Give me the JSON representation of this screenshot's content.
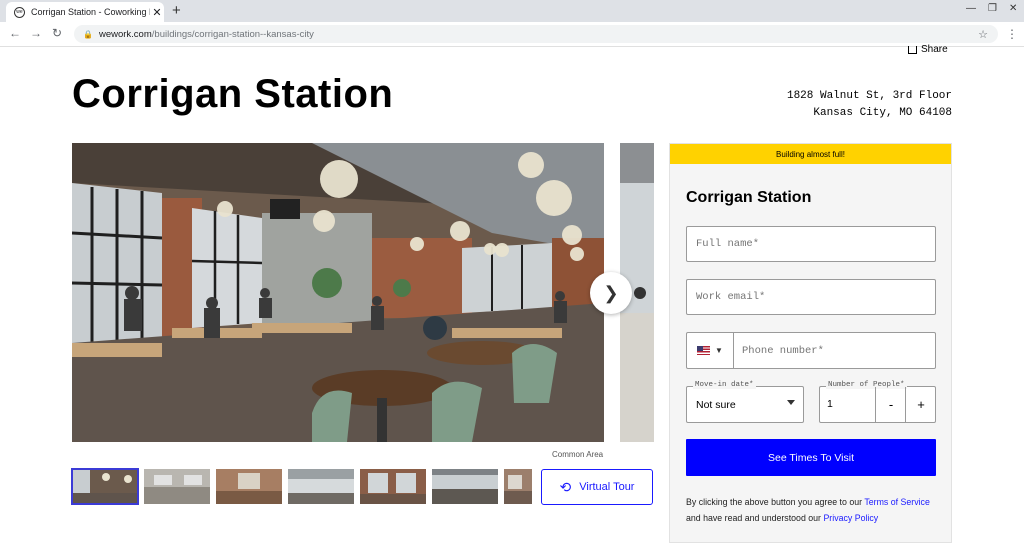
{
  "browser": {
    "tab_title": "Corrigan Station - Coworking Ne",
    "tab_favicon_text": "we",
    "url_host": "wework.com",
    "url_path": "/buildings/corrigan-station--kansas-city"
  },
  "page": {
    "share_label": "Share",
    "title": "Corrigan Station",
    "address_line1": "1828 Walnut St, 3rd Floor",
    "address_line2": "Kansas City, MO 64108",
    "gallery_caption": "Common Area",
    "thumbnails_count": 7,
    "virtual_tour_label": "Virtual Tour"
  },
  "form": {
    "banner": "Building almost full!",
    "title": "Corrigan Station",
    "full_name_placeholder": "Full name*",
    "work_email_placeholder": "Work email*",
    "phone_placeholder": "Phone number*",
    "move_in_label": "Move-in date*",
    "move_in_value": "Not sure",
    "people_label": "Number of People*",
    "people_value": "1",
    "minus_label": "-",
    "plus_label": "+",
    "submit_label": "See Times To Visit",
    "legal_1": "By clicking the above button you agree to our ",
    "terms_link": "Terms of Service",
    "legal_2": " and have read and understood our ",
    "privacy_link": "Privacy Policy"
  },
  "colors": {
    "accent": "#0000ff",
    "banner": "#ffd200"
  }
}
